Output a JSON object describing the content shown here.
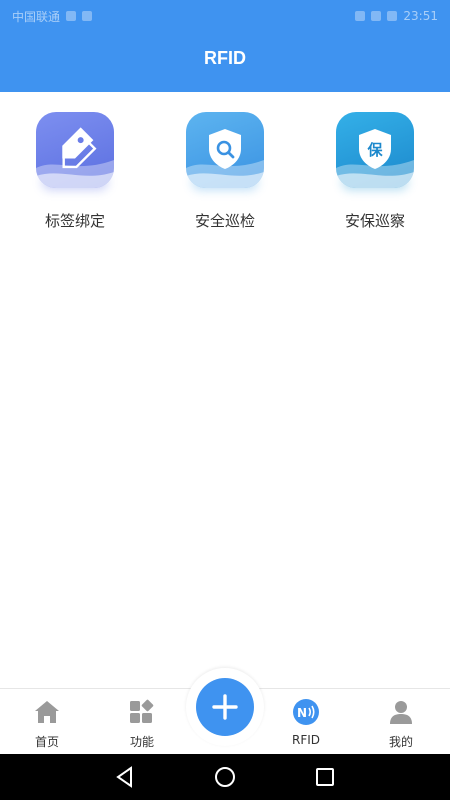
{
  "header": {
    "title": "RFID"
  },
  "status_bar": {
    "left_text": "中国联通",
    "right_text": "23:51"
  },
  "functions": [
    {
      "label": "标签绑定",
      "icon": "tag-icon"
    },
    {
      "label": "安全巡检",
      "icon": "shield-search-icon"
    },
    {
      "label": "安保巡察",
      "icon": "shield-bao-icon",
      "glyph": "保"
    }
  ],
  "bottom_nav": {
    "items": [
      {
        "label": "首页",
        "icon": "home-icon"
      },
      {
        "label": "功能",
        "icon": "grid-icon"
      },
      {
        "label": "RFID",
        "icon": "nfc-icon"
      },
      {
        "label": "我的",
        "icon": "user-icon"
      }
    ],
    "fab_icon": "plus-icon"
  },
  "system_nav": {
    "icons": [
      "back-icon",
      "home-circle-icon",
      "recents-icon"
    ]
  },
  "colors": {
    "primary": "#3f93f0",
    "tile_tag": "#6a7de8",
    "tile_search": "#4aa4e8",
    "tile_bao": "#2e9fd8",
    "nav_inactive": "#9a9a9a",
    "text": "#333333"
  }
}
